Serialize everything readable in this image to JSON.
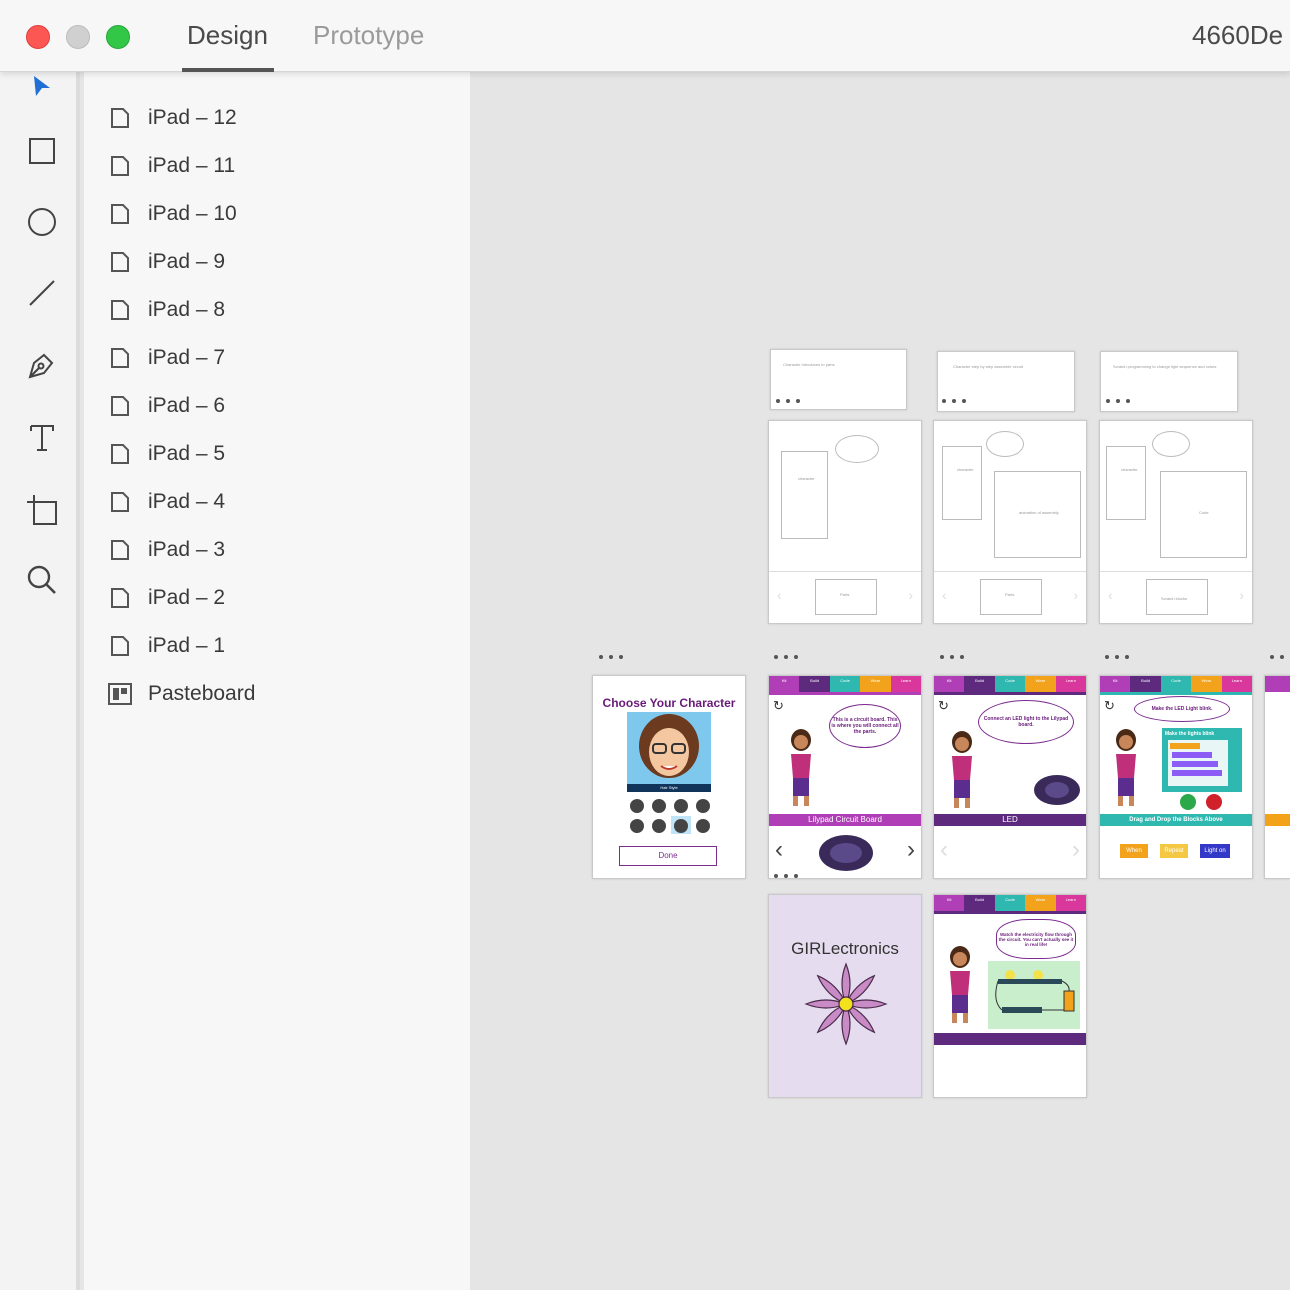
{
  "window": {
    "tabs": [
      {
        "label": "Design",
        "active": true
      },
      {
        "label": "Prototype",
        "active": false
      }
    ],
    "document_title": "4660De"
  },
  "toolbar": {
    "tools": [
      "select-icon",
      "rectangle-icon",
      "ellipse-icon",
      "line-icon",
      "pen-icon",
      "text-icon",
      "artboard-icon",
      "zoom-icon"
    ]
  },
  "layers": {
    "items": [
      {
        "label": "iPad – 12",
        "icon": "artboard-page-icon"
      },
      {
        "label": "iPad – 11",
        "icon": "artboard-page-icon"
      },
      {
        "label": "iPad – 10",
        "icon": "artboard-page-icon"
      },
      {
        "label": "iPad – 9",
        "icon": "artboard-page-icon"
      },
      {
        "label": "iPad – 8",
        "icon": "artboard-page-icon"
      },
      {
        "label": "iPad – 7",
        "icon": "artboard-page-icon"
      },
      {
        "label": "iPad – 6",
        "icon": "artboard-page-icon"
      },
      {
        "label": "iPad – 5",
        "icon": "artboard-page-icon"
      },
      {
        "label": "iPad – 4",
        "icon": "artboard-page-icon"
      },
      {
        "label": "iPad – 3",
        "icon": "artboard-page-icon"
      },
      {
        "label": "iPad – 2",
        "icon": "artboard-page-icon"
      },
      {
        "label": "iPad – 1",
        "icon": "artboard-page-icon"
      },
      {
        "label": "Pasteboard",
        "icon": "pasteboard-icon"
      }
    ]
  },
  "canvas": {
    "wireframes": {
      "notes": [
        "Character introduces to parts",
        "Character step by step assemble circuit",
        "Scratch programming to change light sequence and colors"
      ],
      "left_labels": [
        "character",
        "character",
        "character"
      ],
      "main_labels": [
        "",
        "animation of assembly",
        "Code"
      ],
      "bottom_labels": [
        "Parts",
        "Parts",
        "Scratch blocks"
      ]
    },
    "nav_tabs": [
      "Kit",
      "Build",
      "Code",
      "Wear",
      "Learn"
    ],
    "choose_character": {
      "title": "Choose Your Character",
      "hair_style": "Hair Style",
      "done": "Done"
    },
    "screen_circuit": {
      "bubble": "This is a circuit board. This is where you will connect all the parts.",
      "bar": "Lilypad Circuit Board"
    },
    "screen_led": {
      "bubble": "Connect an LED light to the Lilypad board.",
      "bar": "LED"
    },
    "screen_code": {
      "bubble": "Make the LED Light blink.",
      "code_title": "Make the lights blink",
      "bar": "Drag and Drop the Blocks Above",
      "blocks": [
        "When",
        "Repeat",
        "Light on"
      ]
    },
    "splash": {
      "title": "GIRLectronics"
    },
    "screen_flow": {
      "bubble": "Watch the electricity flow through the circuit. You can't actually see it in real life!"
    }
  }
}
